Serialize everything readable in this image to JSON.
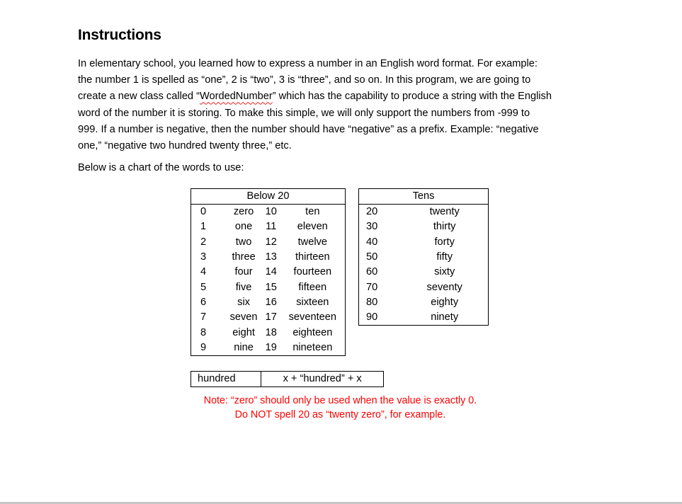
{
  "document": {
    "heading": "Instructions",
    "paragraph_lines": [
      "In elementary school, you learned how to express a number in an English word format.   For example:",
      "the number 1 is spelled as “one”, 2 is “two”, 3 is “three”, and so on.    In this program, we are going to",
      {
        "before": "create a new class called “",
        "flagged_word": "WordedNumber",
        "after": "” which has the capability to produce a string with the English"
      },
      "word of the number it is storing.  To make this simple, we will only support the numbers from -999 to",
      "999.    If a number is negative, then the number should have “negative” as a prefix.  Example: “negative",
      "one,” “negative two hundred twenty three,” etc."
    ],
    "chart_intro": "Below is a chart of the words to use:",
    "spellcheck_underline_color": "#e02020"
  },
  "below20_table": {
    "title": "Below 20",
    "rows": [
      {
        "n1": "0",
        "w1": "zero",
        "n2": "10",
        "w2": "ten"
      },
      {
        "n1": "1",
        "w1": "one",
        "n2": "11",
        "w2": "eleven"
      },
      {
        "n1": "2",
        "w1": "two",
        "n2": "12",
        "w2": "twelve"
      },
      {
        "n1": "3",
        "w1": "three",
        "n2": "13",
        "w2": "thirteen"
      },
      {
        "n1": "4",
        "w1": "four",
        "n2": "14",
        "w2": "fourteen"
      },
      {
        "n1": "5",
        "w1": "five",
        "n2": "15",
        "w2": "fifteen"
      },
      {
        "n1": "6",
        "w1": "six",
        "n2": "16",
        "w2": "sixteen"
      },
      {
        "n1": "7",
        "w1": "seven",
        "n2": "17",
        "w2": "seventeen"
      },
      {
        "n1": "8",
        "w1": "eight",
        "n2": "18",
        "w2": "eighteen"
      },
      {
        "n1": "9",
        "w1": "nine",
        "n2": "19",
        "w2": "nineteen"
      }
    ]
  },
  "tens_table": {
    "title": "Tens",
    "rows": [
      {
        "n": "20",
        "w": "twenty"
      },
      {
        "n": "30",
        "w": "thirty"
      },
      {
        "n": "40",
        "w": "forty"
      },
      {
        "n": "50",
        "w": "fifty"
      },
      {
        "n": "60",
        "w": "sixty"
      },
      {
        "n": "70",
        "w": "seventy"
      },
      {
        "n": "80",
        "w": "eighty"
      },
      {
        "n": "90",
        "w": "ninety"
      }
    ]
  },
  "hundred_table": {
    "label": "hundred",
    "rule": "x + “hundred” + x"
  },
  "note": {
    "line1": "Note: “zero” should only be used when the value is exactly 0.",
    "line2": "Do NOT spell 20 as “twenty zero”, for example.",
    "color": "#ff0000"
  }
}
